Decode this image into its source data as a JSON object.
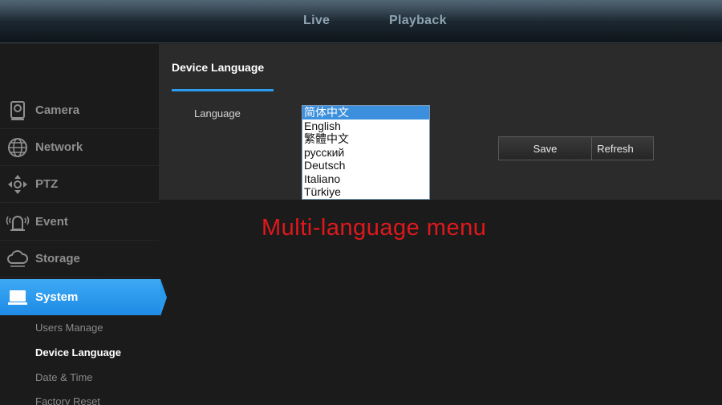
{
  "top_nav": {
    "live": "Live",
    "playback": "Playback"
  },
  "sidebar": {
    "items": [
      {
        "label": "Camera",
        "icon": "camera-icon"
      },
      {
        "label": "Network",
        "icon": "globe-icon"
      },
      {
        "label": "PTZ",
        "icon": "ptz-arrows-icon"
      },
      {
        "label": "Event",
        "icon": "alarm-icon"
      },
      {
        "label": "Storage",
        "icon": "cloud-icon"
      },
      {
        "label": "System",
        "icon": "monitor-icon",
        "active": true
      }
    ],
    "sub_items": [
      {
        "label": "Users Manage"
      },
      {
        "label": "Device Language",
        "active": true
      },
      {
        "label": "Date & Time"
      },
      {
        "label": "Factory Reset"
      }
    ]
  },
  "panel": {
    "tab": "Device Language",
    "language_label": "Language",
    "refresh_label": "Refresh",
    "save_label": "Save",
    "language_options": [
      "简体中文",
      "English",
      "繁體中文",
      "русский",
      "Deutsch",
      "Italiano",
      "Türkiye"
    ],
    "selected_language": "简体中文"
  },
  "caption": "Multi-language menu",
  "colors": {
    "accent": "#2a9bf0",
    "caption": "#e0181c"
  }
}
